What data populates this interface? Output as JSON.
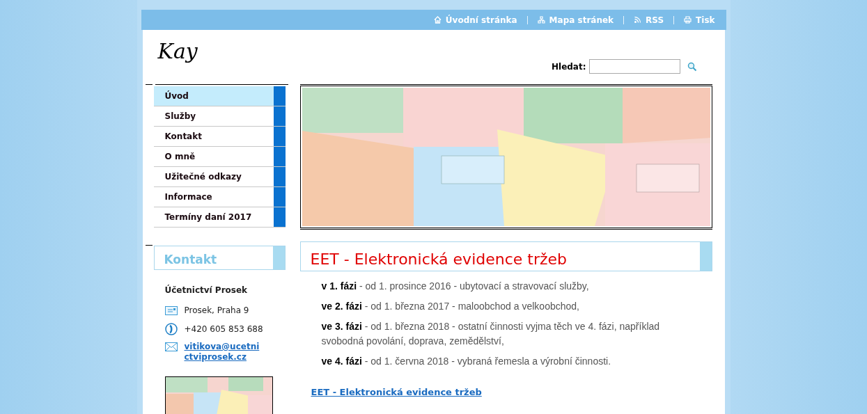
{
  "top_links": [
    {
      "kind": "home",
      "label": "Úvodní stránka"
    },
    {
      "kind": "sitemap",
      "label": "Mapa stránek"
    },
    {
      "kind": "rss",
      "label": "RSS"
    },
    {
      "kind": "print",
      "label": "Tisk"
    }
  ],
  "logo": "Kay",
  "search": {
    "label": "Hledat:"
  },
  "nav": [
    {
      "label": "Úvod",
      "selected": true
    },
    {
      "label": "Služby",
      "selected": false
    },
    {
      "label": "Kontakt",
      "selected": false
    },
    {
      "label": "O mně",
      "selected": false
    },
    {
      "label": "Užitečné odkazy",
      "selected": false
    },
    {
      "label": "Informace",
      "selected": false
    },
    {
      "label": "Termíny daní 2017",
      "selected": false
    }
  ],
  "contact": {
    "title": "Kontakt",
    "company": "Účetnictví Prosek",
    "address": "Prosek, Praha 9",
    "phone": "+420 605 853 688",
    "email": "vitikova@ucetnictviprosek.cz"
  },
  "article": {
    "title": "EET - Elektronická evidence tržeb",
    "phases": [
      "**v 1. fázi** - od 1. prosince 2016 - ubytovací a stravovací služby,",
      "**ve 2. fázi** - od 1. března 2017 - maloobchod a velkoobchod,",
      "**ve 3. fázi** - od 1. března 2018 - ostatní činnosti vyjma těch ve 4. fázi, například svobodná povolání, doprava, zemědělství,",
      "**ve 4. fázi** - od 1. června 2018 - vybraná řemesla a výrobní činnosti."
    ],
    "link": "EET - Elektronická evidence tržeb"
  }
}
